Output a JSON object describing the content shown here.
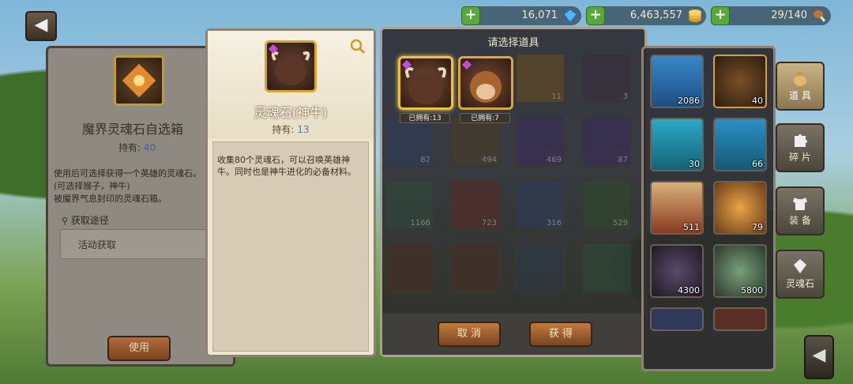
{
  "resources": [
    {
      "value": "16,071",
      "icon": "diamond-icon",
      "color": "#4fb7ff"
    },
    {
      "value": "6,463,557",
      "icon": "gold-coins-icon",
      "color": "#f1b638"
    },
    {
      "value": "29/140",
      "icon": "drumstick-icon",
      "color": "#c8702e"
    }
  ],
  "left": {
    "title": "魔界灵魂石自选箱",
    "hold_label": "持有:",
    "hold_value": "40",
    "desc": "使用后可选择获得一个英雄的灵魂石。(可选择猴子，神牛)",
    "desc2": "被魔界气息封印的灵魂石箱。",
    "route_title": "获取途径",
    "route_item": "活动获取",
    "use_btn": "使用"
  },
  "info": {
    "title": "灵魂石(神牛)",
    "hold_label": "持有:",
    "hold_value": "13",
    "desc": "收集80个灵魂石，可以召唤英雄神牛。同时也是神牛进化的必备材料。"
  },
  "select": {
    "title": "请选择道具",
    "choices": [
      {
        "owned": "已拥有:13",
        "hero": "minotaur-hero-icon"
      },
      {
        "owned": "已拥有:7",
        "hero": "monkey-hero-icon"
      }
    ],
    "bg_counts": [
      "11",
      "3",
      "82",
      "494",
      "469",
      "87",
      "1166",
      "723",
      "316",
      "529"
    ],
    "cancel": "取 消",
    "confirm": "获 得"
  },
  "inventory": {
    "counts": [
      "2086",
      "40",
      "30",
      "66",
      "511",
      "79",
      "4300",
      "5800"
    ]
  },
  "tabs": [
    {
      "label": "道 具",
      "icon": "bag-icon"
    },
    {
      "label": "碎 片",
      "icon": "puzzle-icon"
    },
    {
      "label": "装 备",
      "icon": "armor-icon"
    },
    {
      "label": "灵魂石",
      "icon": "soulstone-icon"
    }
  ]
}
